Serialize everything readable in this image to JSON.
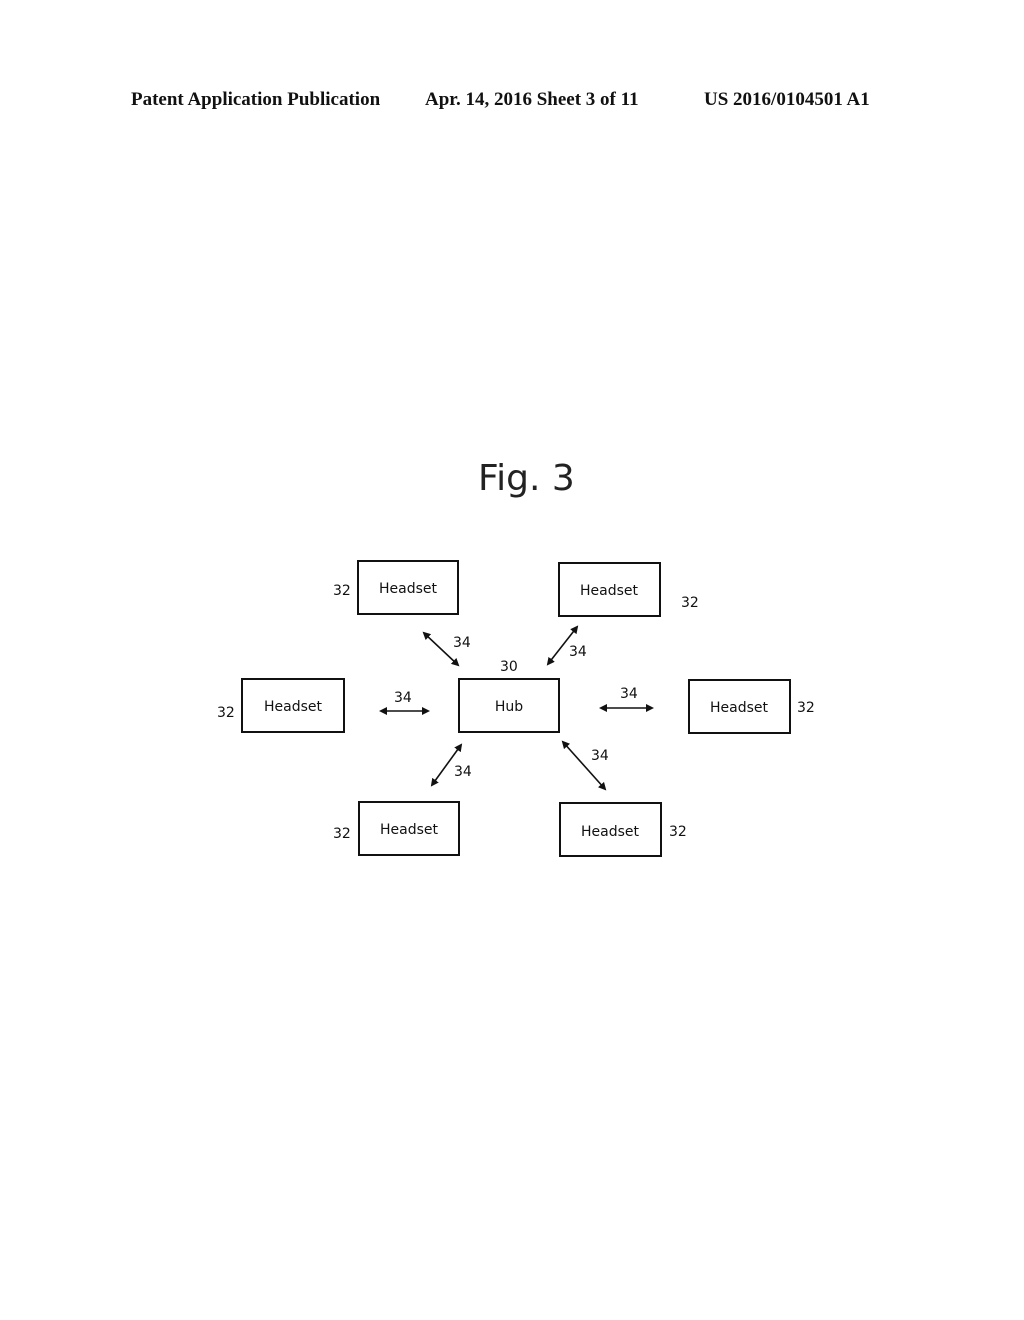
{
  "header": {
    "publication": "Patent Application Publication",
    "date_sheet": "Apr. 14, 2016  Sheet 3 of 11",
    "number": "US 2016/0104501 A1"
  },
  "figure": {
    "title": "Fig. 3",
    "hub": {
      "label": "Hub",
      "ref": "30"
    },
    "headsets": [
      {
        "label": "Headset",
        "ref": "32"
      },
      {
        "label": "Headset",
        "ref": "32"
      },
      {
        "label": "Headset",
        "ref": "32"
      },
      {
        "label": "Headset",
        "ref": "32"
      },
      {
        "label": "Headset",
        "ref": "32"
      },
      {
        "label": "Headset",
        "ref": "32"
      }
    ],
    "link_ref": "34"
  }
}
